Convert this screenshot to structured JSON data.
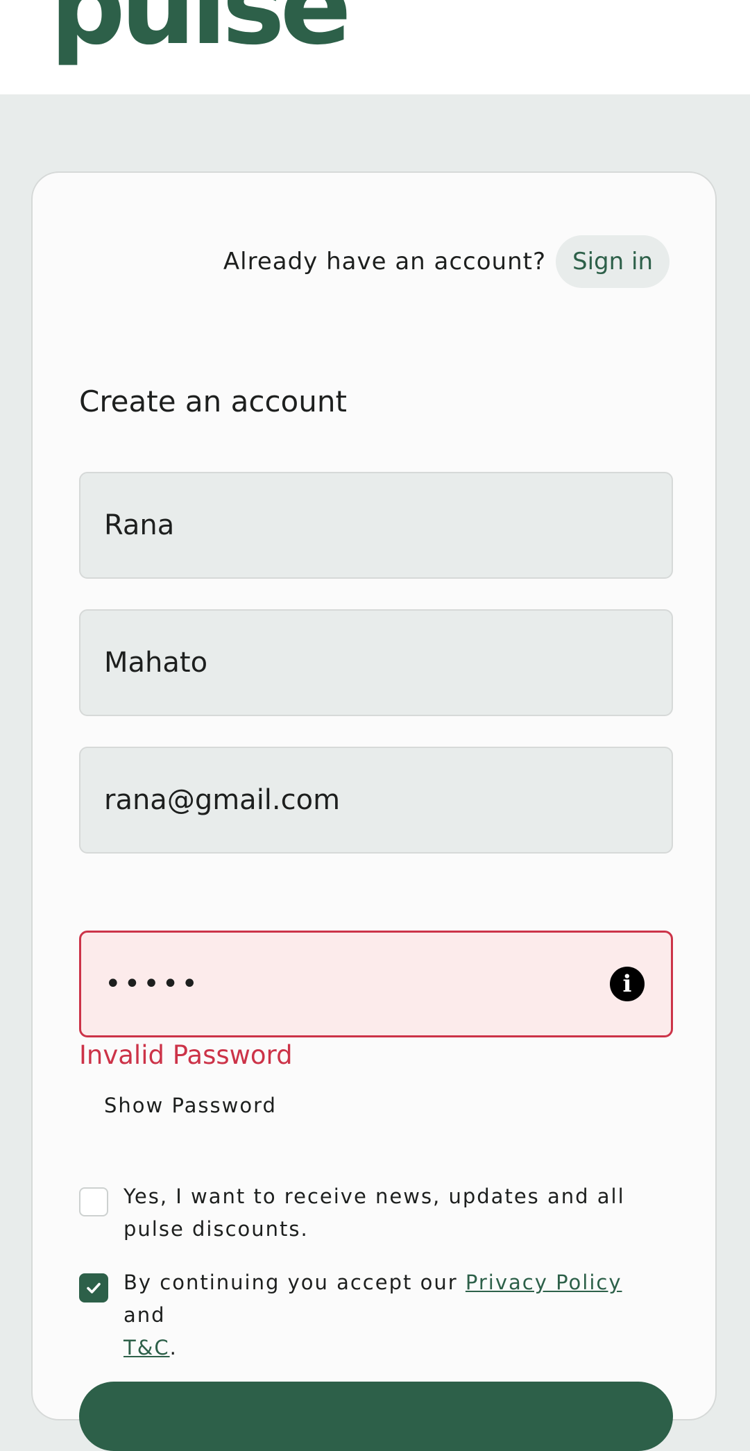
{
  "brand": {
    "logo_text": "pulse",
    "logo_color": "#2d6049"
  },
  "header": {
    "signin_prompt": "Already have an account?",
    "signin_label": "Sign in"
  },
  "form": {
    "title": "Create an account",
    "first_name": "Rana",
    "last_name": "Mahato",
    "email": "rana@gmail.com",
    "password_mask": "•••••",
    "password_info_icon": "info-circle-icon",
    "error": "Invalid Password",
    "error_color": "#cc3348",
    "show_password_label": "Show Password"
  },
  "consent": {
    "news": {
      "checked": false,
      "text": "Yes, I want to receive news, updates and all pulse discounts."
    },
    "terms": {
      "checked": true,
      "text_before": "By continuing you accept our ",
      "privacy_link": "Privacy Policy",
      "text_middle": " and",
      "tc_link": "T&C",
      "text_after": "."
    }
  },
  "colors": {
    "accent": "#2d6049",
    "page_bg": "#e8eceb",
    "input_bg": "#e8eceb",
    "error_input_bg": "#fcebeb"
  }
}
